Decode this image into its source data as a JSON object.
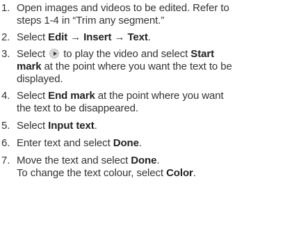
{
  "steps": [
    {
      "number": "1.",
      "line1": "Open images and videos to be edited. Refer to",
      "line2": "steps 1-4 in “Trim any segment.”"
    },
    {
      "number": "2.",
      "prefix": "Select ",
      "bold1": "Edit",
      "arrow1": " → ",
      "bold2": "Insert",
      "arrow2": " → ",
      "bold3": "Text",
      "suffix": "."
    },
    {
      "number": "3.",
      "prefix": "Select ",
      "icon": "play-icon",
      "middle": " to play the video and select ",
      "bold1": "Start",
      "bold2": "mark",
      "line2_rest": " at the point where you want the text to be",
      "line3": "displayed."
    },
    {
      "number": "4.",
      "prefix": "Select ",
      "bold": "End mark",
      "line1_rest": " at the point where you want",
      "line2": "the text to be disappeared."
    },
    {
      "number": "5.",
      "prefix": "Select ",
      "bold": "Input text",
      "suffix": "."
    },
    {
      "number": "6.",
      "prefix": "Enter text and select ",
      "bold": "Done",
      "suffix": "."
    },
    {
      "number": "7.",
      "prefix": "Move the text and select ",
      "bold": "Done",
      "suffix": ".",
      "line2_prefix": "To change the text colour, select ",
      "line2_bold": "Color",
      "line2_suffix": "."
    }
  ]
}
